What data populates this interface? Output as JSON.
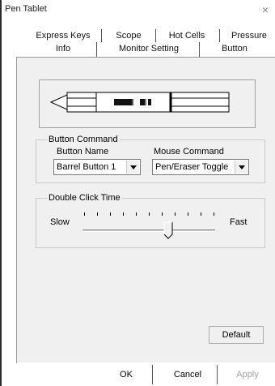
{
  "window": {
    "title": "Pen Tablet",
    "close_glyph": "×"
  },
  "tabs": {
    "row1": [
      {
        "label": "Express Keys"
      },
      {
        "label": "Scope"
      },
      {
        "label": "Hot Cells"
      },
      {
        "label": "Pressure"
      }
    ],
    "row2": [
      {
        "label": "Info"
      },
      {
        "label": "Monitor Setting"
      },
      {
        "label": "Button",
        "active": true
      }
    ]
  },
  "pen_diagram": {
    "icon": "pen-illustration"
  },
  "button_command": {
    "group_label": "Button Command",
    "button_name_label": "Button Name",
    "button_name_value": "Barrel Button 1",
    "mouse_command_label": "Mouse Command",
    "mouse_command_value": "Pen/Eraser Toggle"
  },
  "double_click": {
    "group_label": "Double Click Time",
    "slow_label": "Slow",
    "fast_label": "Fast",
    "tick_count": 11,
    "level_fraction": 0.65
  },
  "buttons": {
    "default": "Default",
    "ok": "OK",
    "cancel": "Cancel",
    "apply": "Apply"
  },
  "colors": {
    "panel_bg": "#f0f0f0",
    "disabled_text": "#a0a0a0"
  }
}
